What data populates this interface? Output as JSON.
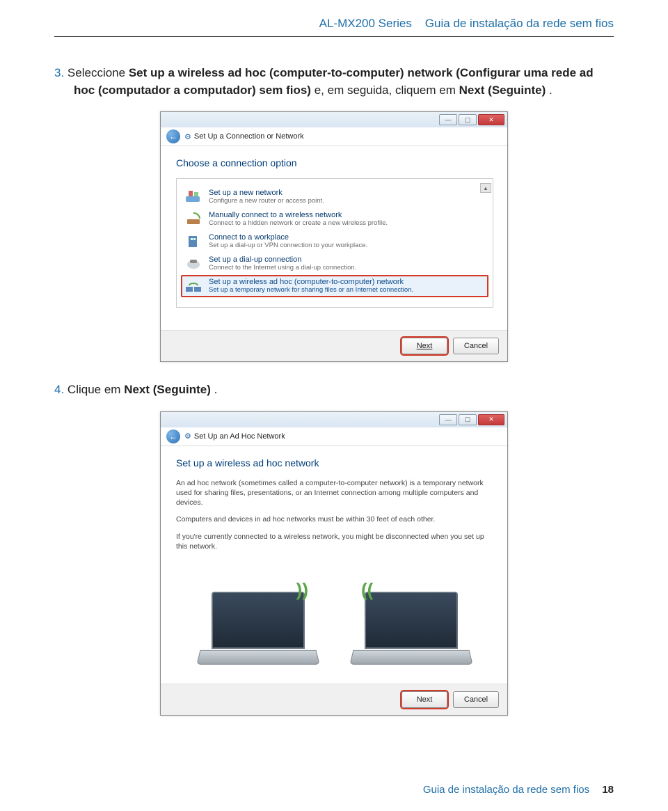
{
  "header": {
    "series": "AL-MX200 Series",
    "doc_title": "Guia de instalação da rede sem fios"
  },
  "step3": {
    "num": "3.",
    "pre": "Seleccione ",
    "bold1": "Set up a wireless ad hoc (computer-to-computer) network (Configurar uma rede ad hoc (computador a computador) sem fios)",
    "mid": " e, em seguida, cliquem em ",
    "bold2": "Next (Seguinte)",
    "post": "."
  },
  "dialog1": {
    "title": "Set Up a Connection or Network",
    "heading": "Choose a connection option",
    "options": [
      {
        "title": "Set up a new network",
        "desc": "Configure a new router or access point."
      },
      {
        "title": "Manually connect to a wireless network",
        "desc": "Connect to a hidden network or create a new wireless profile."
      },
      {
        "title": "Connect to a workplace",
        "desc": "Set up a dial-up or VPN connection to your workplace."
      },
      {
        "title": "Set up a dial-up connection",
        "desc": "Connect to the Internet using a dial-up connection."
      },
      {
        "title": "Set up a wireless ad hoc (computer-to-computer) network",
        "desc": "Set up a temporary network for sharing files or an Internet connection."
      }
    ],
    "next": "Next",
    "cancel": "Cancel"
  },
  "step4": {
    "num": "4.",
    "pre": "Clique em ",
    "bold": "Next (Seguinte)",
    "post": "."
  },
  "dialog2": {
    "title": "Set Up an Ad Hoc Network",
    "heading": "Set up a wireless ad hoc network",
    "p1": "An ad hoc network (sometimes called a computer-to-computer network) is a temporary network used for sharing files, presentations, or an Internet connection among multiple computers and devices.",
    "p2": "Computers and devices in ad hoc networks must be within 30 feet of each other.",
    "p3": "If you're currently connected to a wireless network, you might be disconnected when you set up this network.",
    "next": "Next",
    "cancel": "Cancel"
  },
  "footer": {
    "text": "Guia de instalação da rede sem fios",
    "page": "18"
  },
  "icons": {
    "minimize": "minimize-icon",
    "maximize": "maximize-icon",
    "close": "close-icon",
    "back": "back-arrow-icon",
    "scroll_up": "scroll-up-icon"
  }
}
